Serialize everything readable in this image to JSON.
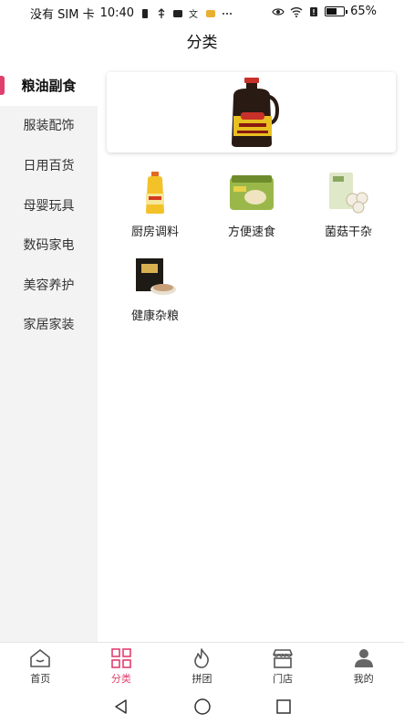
{
  "status_bar": {
    "left_text": "没有 SIM 卡",
    "time": "10:40",
    "battery": "65%",
    "battery_level": 0.65
  },
  "header": {
    "title": "分类"
  },
  "sidebar": {
    "items": [
      {
        "label": "粮油副食",
        "active": true
      },
      {
        "label": "服装配饰"
      },
      {
        "label": "日用百货"
      },
      {
        "label": "母婴玩具"
      },
      {
        "label": "数码家电"
      },
      {
        "label": "美容养护"
      },
      {
        "label": "家居家装"
      }
    ]
  },
  "banner": {
    "icon": "soy-sauce-bottle"
  },
  "categories": [
    {
      "label": "厨房调料",
      "icon": "oil-bottle"
    },
    {
      "label": "方便速食",
      "icon": "noodle-pack"
    },
    {
      "label": "菌菇干杂",
      "icon": "mushroom-pack"
    },
    {
      "label": "健康杂粮",
      "icon": "grain-box"
    }
  ],
  "bottom_nav": {
    "items": [
      {
        "label": "首页",
        "icon": "home-icon"
      },
      {
        "label": "分类",
        "icon": "grid-icon",
        "active": true
      },
      {
        "label": "拼团",
        "icon": "flame-icon"
      },
      {
        "label": "门店",
        "icon": "store-icon"
      },
      {
        "label": "我的",
        "icon": "user-icon"
      }
    ]
  },
  "colors": {
    "accent": "#e0406e",
    "sidebar_bg": "#f3f3f3"
  }
}
